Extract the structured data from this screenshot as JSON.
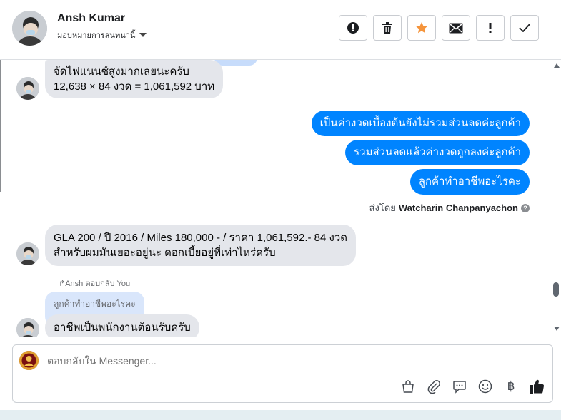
{
  "header": {
    "name": "Ansh Kumar",
    "assign_label": "มอบหมายการสนทนานี้"
  },
  "messages": {
    "m1_line1": "จัดไฟแนนซ์สูงมากเลยนะครับ",
    "m1_line2": "12,638 × 84 งวด = 1,061,592 บาท",
    "out1": "เป็นค่างวดเบื้องต้นยังไม่รวมส่วนลดค่ะลูกค้า",
    "out2": "รวมส่วนลดแล้วค่างวดถูกลงค่ะลูกค้า",
    "out3": "ลูกค้าทำอาชีพอะไรคะ",
    "sent_by_prefix": "ส่งโดย",
    "sent_by_name": "Watcharin Chanpanyachon",
    "m2_line1": "GLA 200 / ปี 2016 / Miles 180,000 - / ราคา 1,061,592.- 84 งวด",
    "m2_line2": "สำหรับผมมันเยอะอยู่นะ ดอกเบี้ยอยู่ที่เท่าไหร่ครับ",
    "reply_note": "Ansh ตอบกลับ You",
    "quoted": "ลูกค้าทำอาชีพอะไรคะ",
    "m3": "อาชีพเป็นพนักงานต้อนรับครับ"
  },
  "composer": {
    "placeholder": "ตอบกลับใน Messenger..."
  },
  "icons": {
    "actions": [
      "alert-circle-icon",
      "trash-icon",
      "star-icon",
      "envelope-icon",
      "exclamation-icon",
      "check-icon"
    ],
    "tools": [
      "shopping-bag-icon",
      "paperclip-icon",
      "speech-bubble-icon",
      "smiley-icon",
      "baht-icon",
      "thumbs-up-icon"
    ]
  },
  "colors": {
    "outgoing_bubble": "#0084ff",
    "incoming_bubble": "#e4e6eb",
    "star": "#f5943b"
  }
}
